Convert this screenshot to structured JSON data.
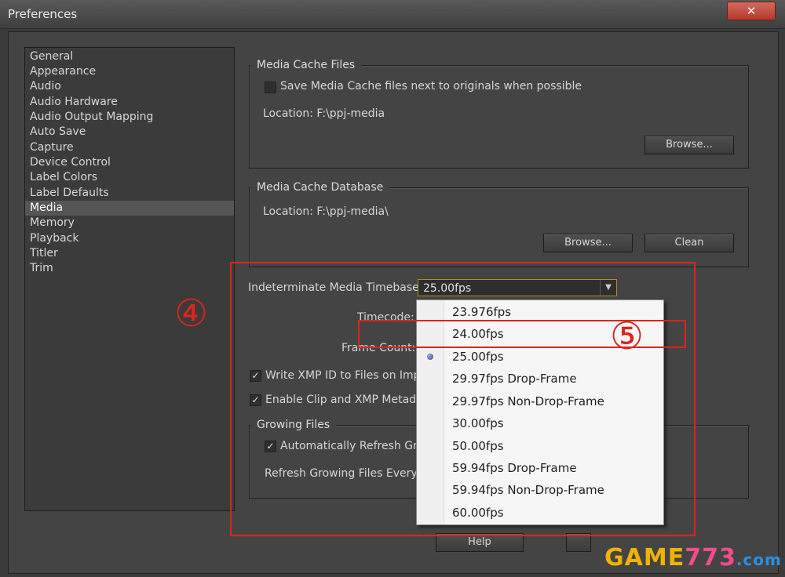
{
  "window": {
    "title": "Preferences",
    "close": "✕"
  },
  "sidebar": {
    "items": [
      "General",
      "Appearance",
      "Audio",
      "Audio Hardware",
      "Audio Output Mapping",
      "Auto Save",
      "Capture",
      "Device Control",
      "Label Colors",
      "Label Defaults",
      "Media",
      "Memory",
      "Playback",
      "Titler",
      "Trim"
    ],
    "selected": "Media"
  },
  "media_cache_files": {
    "legend": "Media Cache Files",
    "checkbox_label": "Save Media Cache files next to originals when possible",
    "location": "Location:  F:\\ppj-media",
    "browse": "Browse..."
  },
  "media_cache_database": {
    "legend": "Media Cache Database",
    "location": "Location:  F:\\ppj-media\\",
    "browse": "Browse...",
    "clean": "Clean"
  },
  "timebase": {
    "label": "Indeterminate Media Timebase:",
    "value": "25.00fps",
    "timecode_label": "Timecode:",
    "frame_count_label": "Frame Count:"
  },
  "options": {
    "write_xmp": "Write XMP ID to Files on Impo",
    "enable_clip": "Enable Clip and XMP Metadat"
  },
  "growing_files": {
    "legend": "Growing Files",
    "auto_refresh": "Automatically Refresh Gro",
    "refresh_every": "Refresh Growing Files Every"
  },
  "dropdown": {
    "options": [
      "23.976fps",
      "24.00fps",
      "25.00fps",
      "29.97fps Drop-Frame",
      "29.97fps Non-Drop-Frame",
      "30.00fps",
      "50.00fps",
      "59.94fps Drop-Frame",
      "59.94fps Non-Drop-Frame",
      "60.00fps"
    ],
    "selected": "25.00fps"
  },
  "footer": {
    "help": "Help"
  },
  "annotations": {
    "step4": "④",
    "step5": "⑤"
  },
  "watermark": {
    "part1": "GAME",
    "part2": "773",
    "part3": ".com"
  },
  "colors": {
    "annotation_red": "#d9261c",
    "select_border": "#b08a2a"
  }
}
